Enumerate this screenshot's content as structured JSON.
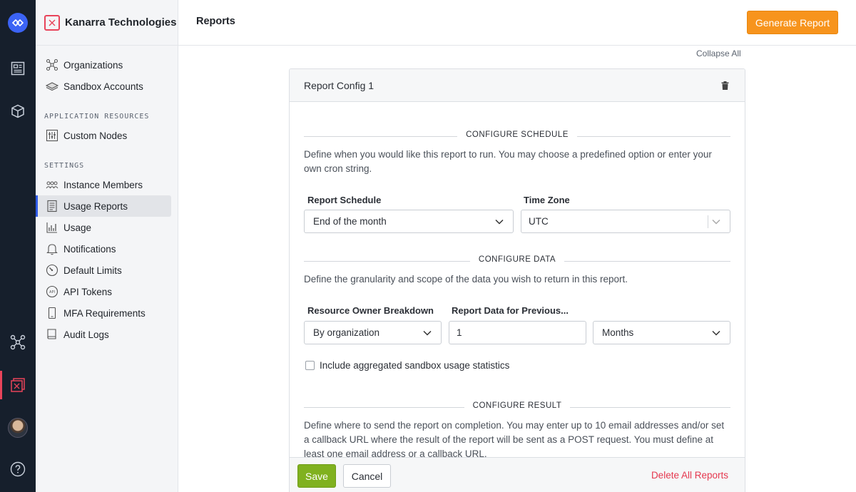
{
  "app": {
    "organization_name": "Kanarra Technologies",
    "page_title": "Reports",
    "generate_button": "Generate Report",
    "collapse_all": "Collapse All"
  },
  "sidebar": {
    "top_items": [
      {
        "label": "Organizations",
        "icon": "network-icon"
      },
      {
        "label": "Sandbox Accounts",
        "icon": "layers-icon"
      }
    ],
    "application_resources_label": "APPLICATION RESOURCES",
    "resource_items": [
      {
        "label": "Custom Nodes",
        "icon": "sliders-icon"
      }
    ],
    "settings_label": "SETTINGS",
    "settings_items": [
      {
        "label": "Instance Members",
        "icon": "members-icon"
      },
      {
        "label": "Usage Reports",
        "icon": "document-icon",
        "active": true
      },
      {
        "label": "Usage",
        "icon": "bar-chart-icon"
      },
      {
        "label": "Notifications",
        "icon": "bell-icon"
      },
      {
        "label": "Default Limits",
        "icon": "gauge-icon"
      },
      {
        "label": "API Tokens",
        "icon": "api-icon"
      },
      {
        "label": "MFA Requirements",
        "icon": "phone-icon"
      },
      {
        "label": "Audit Logs",
        "icon": "book-icon"
      }
    ]
  },
  "report": {
    "title": "Report Config 1",
    "schedule": {
      "section_label": "CONFIGURE SCHEDULE",
      "description": "Define when you would like this report to run. You may choose a predefined option or enter your own cron string.",
      "report_schedule_label": "Report Schedule",
      "report_schedule_value": "End of the month",
      "time_zone_label": "Time Zone",
      "time_zone_value": "UTC"
    },
    "data": {
      "section_label": "CONFIGURE DATA",
      "description": "Define the granularity and scope of the data you wish to return in this report.",
      "owner_breakdown_label": "Resource Owner Breakdown",
      "owner_breakdown_value": "By organization",
      "previous_label": "Report Data for Previous...",
      "previous_value": "1",
      "period_value": "Months",
      "include_sandbox_label": "Include aggregated sandbox usage statistics",
      "include_sandbox_checked": false
    },
    "result": {
      "section_label": "CONFIGURE RESULT",
      "description": "Define where to send the report on completion. You may enter up to 10 email addresses and/or set a callback URL where the result of the report will be sent as a POST request. You must define at least one email address or a callback URL."
    }
  },
  "footer": {
    "save": "Save",
    "cancel": "Cancel",
    "delete_all": "Delete All Reports"
  }
}
